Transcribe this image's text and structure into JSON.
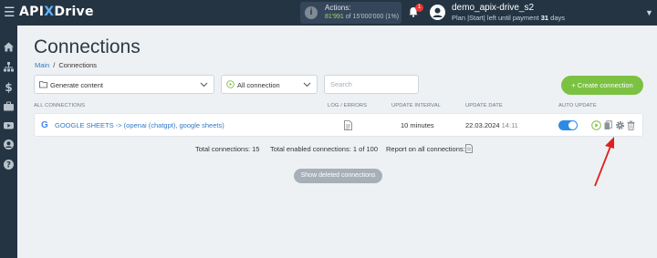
{
  "topbar": {
    "logo_prefix": "API",
    "logo_x": "X",
    "logo_suffix": "Drive",
    "actions_label": "Actions:",
    "actions_used": "81'991",
    "actions_of": "of 15'000'000",
    "actions_pct": "(1%)",
    "notifications_count": "1",
    "user_name": "demo_apix-drive_s2",
    "plan_prefix": "Plan |Start| left until payment",
    "plan_days": "31",
    "plan_suffix": "days"
  },
  "page": {
    "title": "Connections",
    "breadcrumb": [
      "Main",
      "/",
      "Connections"
    ]
  },
  "filters": {
    "folder_value": "Generate content",
    "status_value": "All connection",
    "search_placeholder": "Search",
    "create_label": "+ Create connection"
  },
  "table": {
    "headers": {
      "all": "ALL CONNECTIONS",
      "log": "LOG / ERRORS",
      "interval": "UPDATE INTERVAL",
      "date": "UPDATE DATE",
      "auto": "AUTO UPDATE"
    },
    "rows": [
      {
        "name": "GOOGLE SHEETS -> (openai (chatgpt), google sheets)",
        "interval": "10 minutes",
        "date": "22.03.2024",
        "time": "14:11",
        "auto_update": true
      }
    ]
  },
  "totals": {
    "total": "Total connections: 15",
    "enabled": "Total enabled connections: 1 of 100",
    "report": "Report on all connections:"
  },
  "show_deleted_label": "Show deleted connections",
  "colors": {
    "topbar": "#243443",
    "accent_green": "#7cc242",
    "link_blue": "#2f7bc4",
    "toggle_blue": "#2d8be6",
    "arrow_red": "#e02020"
  },
  "icons": {
    "sidebar": [
      "home-icon",
      "sitemap-icon",
      "dollar-icon",
      "briefcase-icon",
      "youtube-icon",
      "user-circle-icon",
      "help-icon"
    ],
    "row_actions": [
      "play-icon",
      "copy-icon",
      "gear-icon",
      "trash-icon"
    ]
  }
}
